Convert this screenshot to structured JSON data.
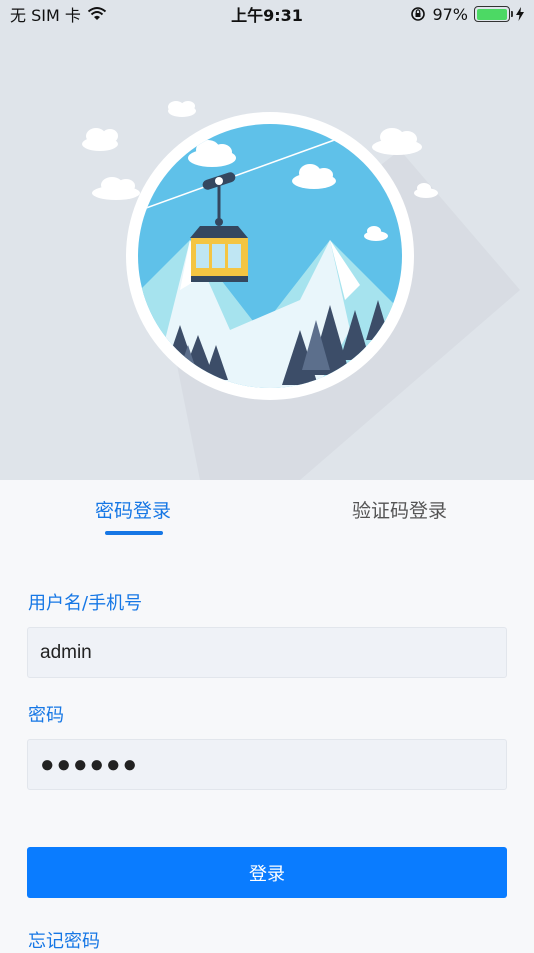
{
  "status_bar": {
    "carrier": "无 SIM 卡",
    "time": "上午9:31",
    "battery_percent": "97%",
    "battery_level": 0.97
  },
  "tabs": [
    {
      "label": "密码登录",
      "active": true
    },
    {
      "label": "验证码登录",
      "active": false
    }
  ],
  "form": {
    "username_label": "用户名/手机号",
    "username_value": "admin",
    "password_label": "密码",
    "password_masked": "●●●●●●",
    "login_label": "登录",
    "forgot_label": "忘记密码"
  },
  "colors": {
    "accent": "#1677e5",
    "button": "#0a7cff",
    "hero_bg": "#dfe4ea",
    "sky": "#5fc1e9"
  }
}
